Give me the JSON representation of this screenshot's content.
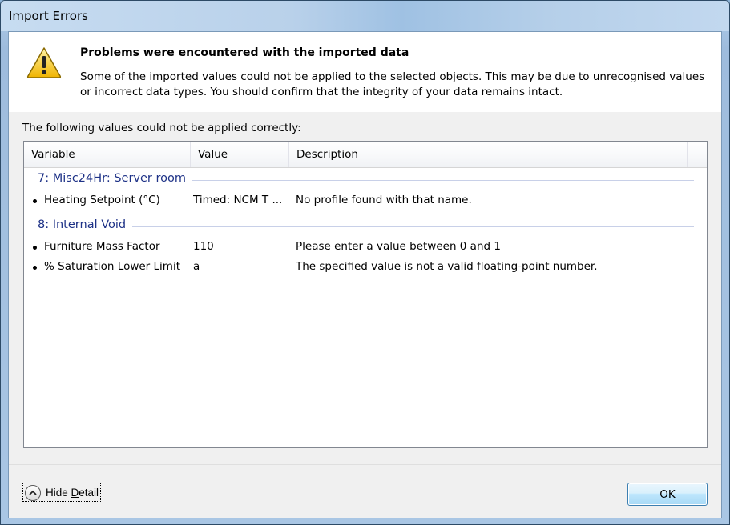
{
  "window": {
    "title": "Import Errors"
  },
  "header": {
    "title": "Problems were encountered with the imported data",
    "description": "Some of the imported values could not be applied to the selected objects. This may be due to unrecognised values or incorrect data types. You should confirm that the integrity of your data remains intact.",
    "icon": "warning-icon"
  },
  "body": {
    "intro": "The following values could not be applied correctly:",
    "columns": [
      "Variable",
      "Value",
      "Description"
    ],
    "groups": [
      {
        "label": "7: Misc24Hr: Server room",
        "items": [
          {
            "variable": "Heating Setpoint (°C)",
            "value": "Timed: NCM T ...",
            "description": "No profile found with that name."
          }
        ]
      },
      {
        "label": "8: Internal Void",
        "items": [
          {
            "variable": "Furniture Mass Factor",
            "value": "110",
            "description": "Please enter a value between 0 and 1"
          },
          {
            "variable": "% Saturation Lower Limit",
            "value": "a",
            "description": "The specified value is not a valid floating-point number."
          }
        ]
      }
    ]
  },
  "footer": {
    "detail_label_prefix": "Hide ",
    "detail_label_mnemonic": "D",
    "detail_label_suffix": "etail",
    "ok_label": "OK"
  },
  "colors": {
    "group_text": "#1e3287",
    "ok_border": "#3c7fb1"
  }
}
